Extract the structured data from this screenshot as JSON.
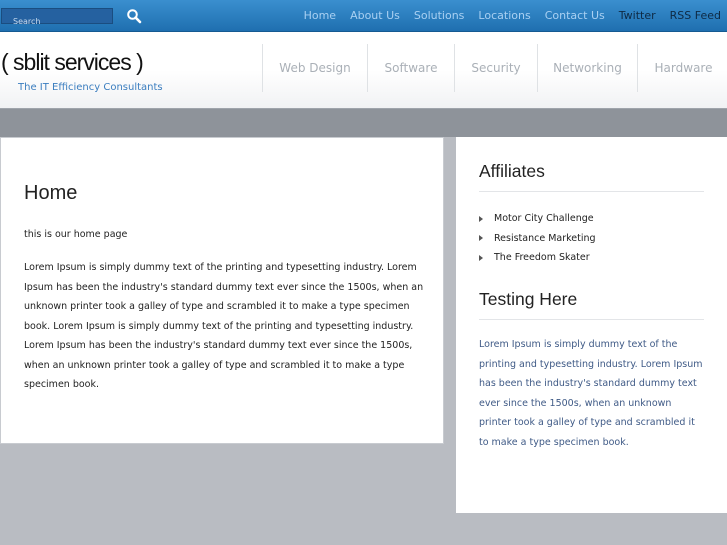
{
  "search": {
    "placeholder": "Search"
  },
  "top_nav": [
    "Home",
    "About Us",
    "Solutions",
    "Locations",
    "Contact Us",
    "Twitter",
    "RSS Feed"
  ],
  "site": {
    "title": "( sblit services )",
    "tagline": "The IT Efficiency Consultants"
  },
  "main_nav": [
    "Web Design",
    "Software",
    "Security",
    "Networking",
    "Hardware"
  ],
  "content": {
    "heading": "Home",
    "intro": "this is our home page",
    "body": "Lorem Ipsum is simply dummy text of the printing and typesetting industry. Lorem Ipsum has been the industry's standard dummy text ever since the 1500s, when an unknown printer took a galley of type and scrambled it to make a type specimen book. Lorem Ipsum is simply dummy text of the printing and typesetting industry. Lorem Ipsum has been the industry's standard dummy text ever since the 1500s, when an unknown printer took a galley of type and scrambled it to make a type specimen book."
  },
  "sidebar": {
    "affiliates_heading": "Affiliates",
    "affiliates": [
      "Motor City Challenge",
      "Resistance Marketing",
      "The Freedom Skater"
    ],
    "testing_heading": "Testing Here",
    "testing_text": "Lorem Ipsum is simply dummy text of the printing and typesetting industry. Lorem Ipsum has been the industry's standard dummy text ever since the 1500s, when an unknown printer took a galley of type and scrambled it to make a type specimen book."
  },
  "icons": {
    "search_button": "search-icon",
    "list_bullet": "triangle-bullet-icon"
  }
}
